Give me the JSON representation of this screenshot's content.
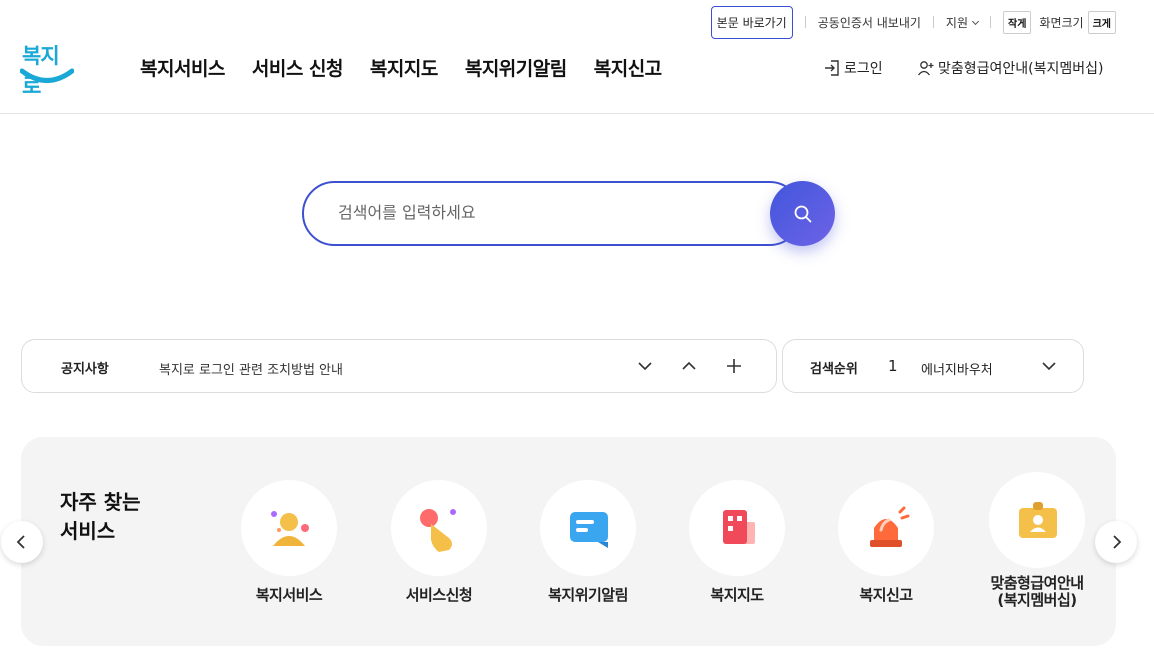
{
  "util": {
    "skip_link": "본문 바로가기",
    "cert_export": "공동인증서 내보내기",
    "support": "지원",
    "size_small": "작게",
    "zoom_label": "화면크기",
    "size_large": "크게"
  },
  "logo": {
    "text": "복지로"
  },
  "gnb": [
    "복지서비스",
    "서비스 신청",
    "복지지도",
    "복지위기알림",
    "복지신고"
  ],
  "header": {
    "login": "로그인",
    "membership": "맞춤형급여안내(복지멤버십)"
  },
  "search": {
    "placeholder": "검색어를 입력하세요"
  },
  "notice": {
    "label": "공지사항",
    "text": "복지로 로그인 관련 조치방법 안내"
  },
  "ranking": {
    "label": "검색순위",
    "rank": "1",
    "term": "에너지바우처"
  },
  "frequent": {
    "title_line1": "자주 찾는",
    "title_line2": "서비스",
    "items": [
      {
        "label": "복지서비스",
        "icon": "person-icon"
      },
      {
        "label": "서비스신청",
        "icon": "hand-tap-icon"
      },
      {
        "label": "복지위기알림",
        "icon": "message-icon"
      },
      {
        "label": "복지지도",
        "icon": "building-icon"
      },
      {
        "label": "복지신고",
        "icon": "siren-icon"
      },
      {
        "label": "맞춤형급여안내\n(복지멤버십)",
        "icon": "id-card-icon"
      }
    ]
  },
  "colors": {
    "accent": "#3d50d0",
    "logo": "#1aa9d6",
    "panel_bg": "#f4f4f4"
  }
}
